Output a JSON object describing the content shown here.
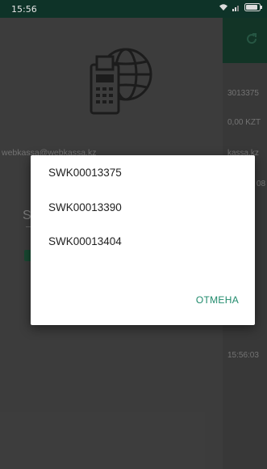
{
  "status_bar": {
    "time": "15:56",
    "icons": [
      "wifi-icon",
      "signal-icon",
      "battery-icon"
    ]
  },
  "drawer": {
    "logo": "cash-register-globe-logo",
    "email": "webkassa@webkassa.kz",
    "field_value": "S"
  },
  "background_screen": {
    "rows": [
      "3013375",
      "0,00 KZT",
      "kassa.kz",
      "08",
      "",
      "15:56:03"
    ]
  },
  "dialog": {
    "items": [
      "SWK00013375",
      "SWK00013390",
      "SWK00013404"
    ],
    "cancel_label": "ОТМЕНА"
  },
  "colors": {
    "status_bar": "#0e3328",
    "header": "#17402f",
    "accent": "#1f8a6b",
    "dialog_bg": "#ffffff"
  }
}
